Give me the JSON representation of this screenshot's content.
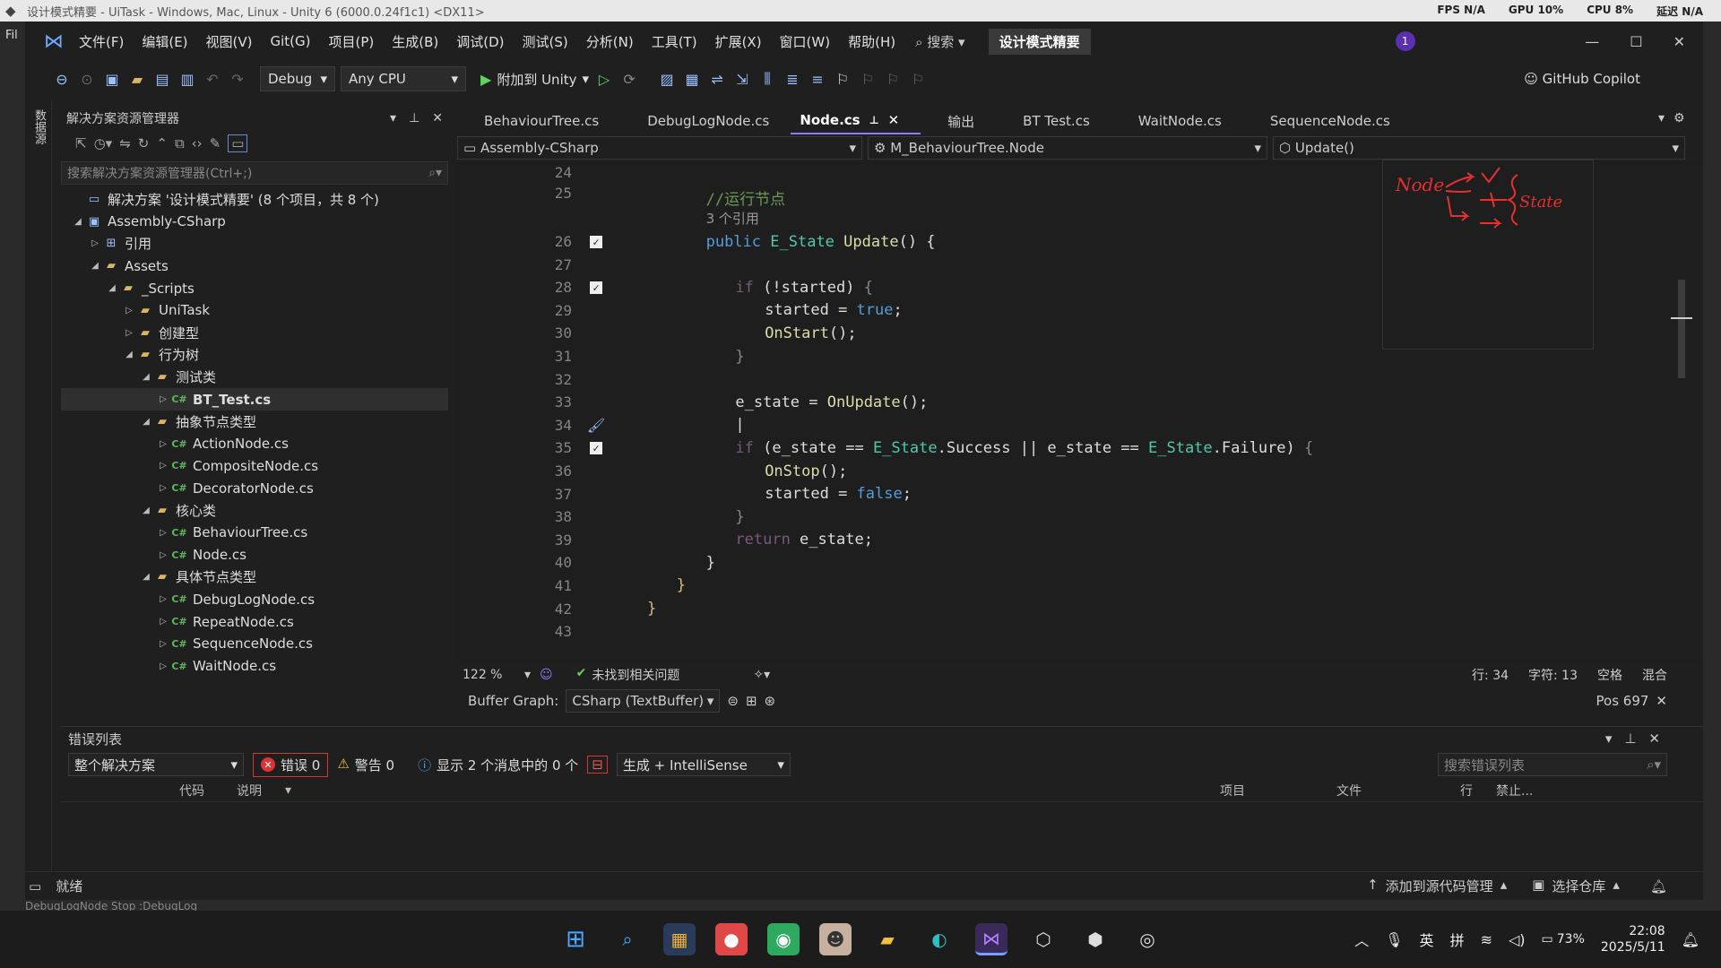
{
  "unity": {
    "title": "设计模式精要 - UiTask - Windows, Mac, Linux - Unity 6 (6000.0.24f1c1) <DX11>",
    "stats": [
      "FPS N/A",
      "GPU 10%",
      "CPU 8%",
      "延迟 N/A"
    ],
    "file_label": "Fil",
    "console_line": "DebugLogNode Stop :DebugLog"
  },
  "menu": {
    "items": [
      "文件(F)",
      "编辑(E)",
      "视图(V)",
      "Git(G)",
      "项目(P)",
      "生成(B)",
      "调试(D)",
      "测试(S)",
      "分析(N)",
      "工具(T)",
      "扩展(X)",
      "窗口(W)",
      "帮助(H)"
    ],
    "search": "搜索",
    "solution_name": "设计模式精要",
    "notification_count": "1"
  },
  "toolbar": {
    "config": "Debug",
    "platform": "Any CPU",
    "attach": "附加到 Unity",
    "copilot": "GitHub Copilot"
  },
  "solution_explorer": {
    "title": "解决方案资源管理器",
    "search_placeholder": "搜索解决方案资源管理器(Ctrl+;)",
    "side_tab": "数据源",
    "tree": [
      {
        "label": "解决方案 '设计模式精要' (8 个项目，共 8 个)",
        "icon": "solution",
        "indent": 0,
        "arrow": ""
      },
      {
        "label": "Assembly-CSharp",
        "icon": "project",
        "indent": 0,
        "arrow": "open"
      },
      {
        "label": "引用",
        "icon": "references",
        "indent": 1,
        "arrow": "closed"
      },
      {
        "label": "Assets",
        "icon": "folder",
        "indent": 1,
        "arrow": "open"
      },
      {
        "label": "_Scripts",
        "icon": "folder",
        "indent": 2,
        "arrow": "open"
      },
      {
        "label": "UniTask",
        "icon": "folder",
        "indent": 3,
        "arrow": "closed"
      },
      {
        "label": "创建型",
        "icon": "folder",
        "indent": 3,
        "arrow": "closed"
      },
      {
        "label": "行为树",
        "icon": "folder",
        "indent": 3,
        "arrow": "open"
      },
      {
        "label": "测试类",
        "icon": "folder",
        "indent": 4,
        "arrow": "open"
      },
      {
        "label": "BT_Test.cs",
        "icon": "cs",
        "indent": 5,
        "arrow": "closed",
        "selected": true
      },
      {
        "label": "抽象节点类型",
        "icon": "folder",
        "indent": 4,
        "arrow": "open"
      },
      {
        "label": "ActionNode.cs",
        "icon": "cs",
        "indent": 5,
        "arrow": "closed"
      },
      {
        "label": "CompositeNode.cs",
        "icon": "cs",
        "indent": 5,
        "arrow": "closed"
      },
      {
        "label": "DecoratorNode.cs",
        "icon": "cs",
        "indent": 5,
        "arrow": "closed"
      },
      {
        "label": "核心类",
        "icon": "folder",
        "indent": 4,
        "arrow": "open"
      },
      {
        "label": "BehaviourTree.cs",
        "icon": "cs",
        "indent": 5,
        "arrow": "closed"
      },
      {
        "label": "Node.cs",
        "icon": "cs",
        "indent": 5,
        "arrow": "closed"
      },
      {
        "label": "具体节点类型",
        "icon": "folder",
        "indent": 4,
        "arrow": "open"
      },
      {
        "label": "DebugLogNode.cs",
        "icon": "cs",
        "indent": 5,
        "arrow": "closed"
      },
      {
        "label": "RepeatNode.cs",
        "icon": "cs",
        "indent": 5,
        "arrow": "closed"
      },
      {
        "label": "SequenceNode.cs",
        "icon": "cs",
        "indent": 5,
        "arrow": "closed"
      },
      {
        "label": "WaitNode.cs",
        "icon": "cs",
        "indent": 5,
        "arrow": "closed"
      }
    ]
  },
  "editor": {
    "tabs": [
      {
        "label": "BehaviourTree.cs",
        "active": false
      },
      {
        "label": "DebugLogNode.cs",
        "active": false
      },
      {
        "label": "Node.cs",
        "active": true
      },
      {
        "label": "输出",
        "active": false
      },
      {
        "label": "BT Test.cs",
        "active": false
      },
      {
        "label": "WaitNode.cs",
        "active": false
      },
      {
        "label": "SequenceNode.cs",
        "active": false
      }
    ],
    "nav": {
      "project": "Assembly-CSharp",
      "type": "M_BehaviourTree.Node",
      "member": "Update()"
    },
    "lines": [
      {
        "n": "24",
        "html": ""
      },
      {
        "n": "25",
        "html": "<span class='cm'>//运行节点</span><br><span class='cmg' style='font-family:DejaVu Sans,sans-serif;font-size:15px'>3 个引用</span>",
        "indent": 8
      },
      {
        "n": "26",
        "html": "<span class='kw'>public</span> <span class='ty'>E_State</span> <span class='fn'>Update</span>() {",
        "indent": 8,
        "fold": true
      },
      {
        "n": "27",
        "html": ""
      },
      {
        "n": "28",
        "html": "<span class='ctrl dim'>if</span> (!started) <span class='dim'>{</span>",
        "indent": 12,
        "fold": true
      },
      {
        "n": "29",
        "html": "started = <span class='kw'>true</span>;",
        "indent": 16
      },
      {
        "n": "30",
        "html": "<span class='fn'>OnStart</span>();",
        "indent": 16
      },
      {
        "n": "31",
        "html": "<span class='dim'>}</span>",
        "indent": 12
      },
      {
        "n": "32",
        "html": ""
      },
      {
        "n": "33",
        "html": "e_state = <span class='fn'>OnUpdate</span>();",
        "indent": 12
      },
      {
        "n": "34",
        "html": "|",
        "indent": 12
      },
      {
        "n": "35",
        "html": "<span class='ctrl dim'>if</span> (e_state == <span class='ty'>E_State</span>.Success || e_state == <span class='ty'>E_State</span>.Failure) <span class='dim'>{</span>",
        "indent": 12,
        "fold": true
      },
      {
        "n": "36",
        "html": "<span class='fn'>OnStop</span>();",
        "indent": 16
      },
      {
        "n": "37",
        "html": "started = <span class='kw'>false</span>;",
        "indent": 16
      },
      {
        "n": "38",
        "html": "<span class='dim'>}</span>",
        "indent": 12
      },
      {
        "n": "39",
        "html": "<span class='ctrl dim'>return</span> e_state;",
        "indent": 12
      },
      {
        "n": "40",
        "html": "}",
        "indent": 8
      },
      {
        "n": "41",
        "html": "<span class='br'>}</span>",
        "indent": 4
      },
      {
        "n": "42",
        "html": "<span class='br'>}</span>",
        "indent": 0
      },
      {
        "n": "43",
        "html": ""
      }
    ],
    "sketch": {
      "node": "Node",
      "state": "State"
    },
    "status": {
      "zoom": "122 %",
      "issues": "未找到相关问题",
      "line": "行: 34",
      "char": "字符: 13",
      "whitespace": "空格",
      "encoding": "混合",
      "buffer_label": "Buffer Graph:",
      "buffer_value": "CSharp (TextBuffer)",
      "pos": "Pos 697"
    }
  },
  "error_list": {
    "title": "错误列表",
    "scope": "整个解决方案",
    "errors": "错误 0",
    "warnings": "警告 0",
    "messages": "显示 2 个消息中的 0 个",
    "build": "生成 + IntelliSense",
    "search_placeholder": "搜索错误列表",
    "columns": [
      "代码",
      "说明",
      "项目",
      "文件",
      "行",
      "禁止..."
    ]
  },
  "statusbar": {
    "ready": "就绪",
    "source_control": "添加到源代码管理",
    "repo": "选择仓库"
  },
  "taskbar": {
    "apps": [
      "windows",
      "search",
      "store",
      "app-red",
      "app-green",
      "app-avatar",
      "file-explorer",
      "edge",
      "visual-studio",
      "unity",
      "unity-hub",
      "app-chrome"
    ],
    "ime1": "英",
    "ime2": "拼",
    "battery": "73%",
    "time": "22:08",
    "date": "2025/5/11"
  }
}
